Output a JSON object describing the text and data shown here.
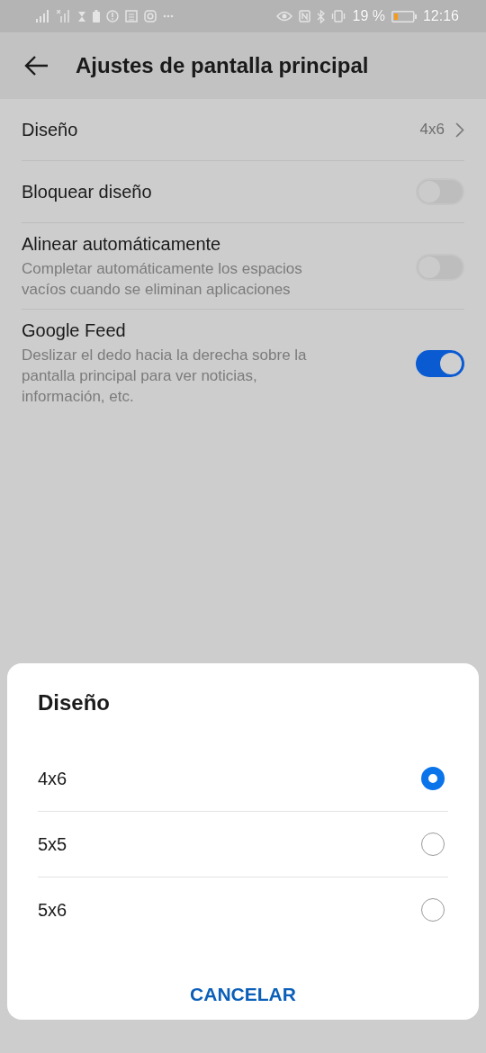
{
  "status_bar": {
    "battery": "19 %",
    "time": "12:16"
  },
  "header": {
    "title": "Ajustes de pantalla principal"
  },
  "settings": [
    {
      "kind": "value",
      "title": "Diseño",
      "value": "4x6"
    },
    {
      "kind": "switch",
      "title": "Bloquear diseño",
      "on": false
    },
    {
      "kind": "switch",
      "title": "Alinear automáticamente",
      "subtitle": "Completar automáticamente los espacios vacíos cuando se eliminan aplicaciones",
      "on": false
    },
    {
      "kind": "switch",
      "title": "Google Feed",
      "subtitle": "Deslizar el dedo hacia la derecha sobre la pantalla principal para ver noticias, información, etc.",
      "on": true
    }
  ],
  "dialog": {
    "title": "Diseño",
    "options": [
      {
        "label": "4x6",
        "selected": true
      },
      {
        "label": "5x5",
        "selected": false
      },
      {
        "label": "5x6",
        "selected": false
      }
    ],
    "cancel": "CANCELAR"
  }
}
